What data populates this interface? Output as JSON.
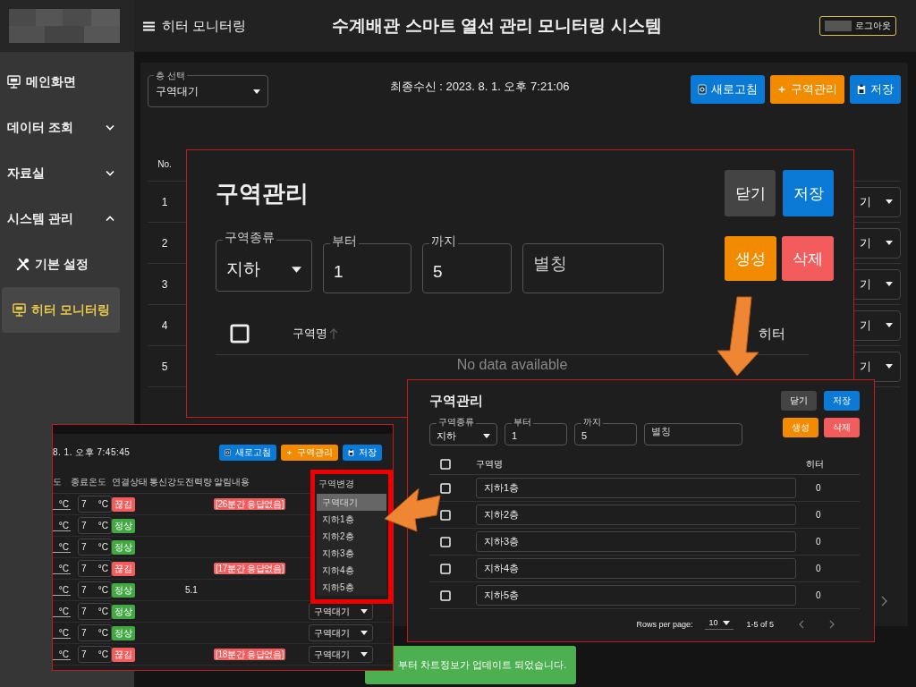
{
  "header": {
    "menu_title": "히터 모니터링",
    "title": "수계배관 스마트 열선 관리 모니터링 시스템",
    "logout": "로그아웃"
  },
  "sidebar": {
    "items": [
      {
        "label": "메인화면",
        "kind": "screen",
        "selected": false
      },
      {
        "label": "데이터 조회",
        "kind": "group",
        "expanded": false,
        "selected": false
      },
      {
        "label": "자료실",
        "kind": "group",
        "expanded": false,
        "selected": false
      },
      {
        "label": "시스템 관리",
        "kind": "group",
        "expanded": true,
        "selected": false,
        "children": [
          {
            "label": "기본 설정",
            "kind": "tools",
            "selected": false
          },
          {
            "label": "히터 모니터링",
            "kind": "screen",
            "selected": true
          }
        ]
      }
    ]
  },
  "toolbar": {
    "floor_select": {
      "label": "층 선택",
      "value": "구역대기"
    },
    "last_received": "최종수신 : 2023. 8. 1. 오후 7:21:06",
    "buttons": [
      {
        "label": "새로고침",
        "kind": "refresh"
      },
      {
        "label": "구역관리",
        "kind": "add"
      },
      {
        "label": "저장",
        "kind": "save"
      }
    ]
  },
  "table": {
    "columns": [
      "No."
    ],
    "rows": [
      {
        "no": "1",
        "zone": "기"
      },
      {
        "no": "2",
        "zone": "기"
      },
      {
        "no": "3",
        "zone": "기"
      },
      {
        "no": "4",
        "zone": "기"
      },
      {
        "no": "5",
        "zone": "기"
      }
    ]
  },
  "zone_dialog": {
    "title": "구역관리",
    "buttons": [
      {
        "label": "닫기",
        "kind": "close"
      },
      {
        "label": "저장",
        "kind": "save"
      }
    ],
    "zone_type": {
      "label": "구역종류",
      "value": "지하"
    },
    "from": {
      "label": "부터",
      "value": "1"
    },
    "to": {
      "label": "까지",
      "value": "5"
    },
    "alias": {
      "placeholder": "별칭"
    },
    "actions": [
      {
        "label": "생성",
        "kind": "create"
      },
      {
        "label": "삭제",
        "kind": "delete"
      }
    ],
    "select_all": {
      "checked": false
    },
    "columns": [
      "구역명",
      "히터"
    ],
    "empty": "No data available"
  },
  "zone_dialog_result": {
    "title": "구역관리",
    "buttons": [
      {
        "label": "닫기",
        "kind": "close"
      },
      {
        "label": "저장",
        "kind": "save"
      }
    ],
    "zone_type": {
      "label": "구역종류",
      "value": "지하"
    },
    "from": {
      "label": "부터",
      "value": "1"
    },
    "to": {
      "label": "까지",
      "value": "5"
    },
    "alias": {
      "placeholder": "별칭"
    },
    "actions": [
      {
        "label": "생성",
        "kind": "create"
      },
      {
        "label": "삭제",
        "kind": "delete"
      }
    ],
    "select_all": {
      "checked": false
    },
    "columns": [
      "구역명",
      "히터"
    ],
    "rows": [
      {
        "name": "지하1층",
        "heater": "0",
        "checked": false
      },
      {
        "name": "지하2층",
        "heater": "0",
        "checked": false
      },
      {
        "name": "지하3층",
        "heater": "0",
        "checked": false
      },
      {
        "name": "지하4층",
        "heater": "0",
        "checked": false
      },
      {
        "name": "지하5층",
        "heater": "0",
        "checked": false
      }
    ],
    "pagination": {
      "label": "Rows per page:",
      "rows_per_page": "10",
      "range": "1-5 of 5"
    }
  },
  "monitor_inset": {
    "last_received": "8. 1. 오후 7:45:45",
    "buttons": [
      {
        "label": "새로고침",
        "kind": "refresh"
      },
      {
        "label": "구역관리",
        "kind": "add"
      },
      {
        "label": "저장",
        "kind": "save"
      }
    ],
    "columns": [
      "도",
      "종료온도",
      "연결상태",
      "통신강도",
      "전력량",
      "알림내용",
      "구역변경"
    ],
    "rows": [
      {
        "start_unit": "°C",
        "end_value": "7",
        "end_unit": "°C",
        "status": {
          "label": "끊김",
          "kind": "error"
        },
        "alert": "[26분간 응답없음]"
      },
      {
        "start_unit": "°C",
        "end_value": "7",
        "end_unit": "°C",
        "status": {
          "label": "정상",
          "kind": "ok"
        }
      },
      {
        "start_unit": "°C",
        "end_value": "7",
        "end_unit": "°C",
        "status": {
          "label": "정상",
          "kind": "ok"
        }
      },
      {
        "start_unit": "°C",
        "end_value": "7",
        "end_unit": "°C",
        "status": {
          "label": "끊김",
          "kind": "error"
        },
        "alert": "[17분간 응답없음]"
      },
      {
        "start_unit": "°C",
        "end_value": "7",
        "end_unit": "°C",
        "status": {
          "label": "정상",
          "kind": "ok"
        },
        "power": "5.1"
      },
      {
        "start_unit": "°C",
        "end_value": "7",
        "end_unit": "°C",
        "status": {
          "label": "정상",
          "kind": "ok"
        },
        "zone": "구역대기"
      },
      {
        "start_unit": "°C",
        "end_value": "7",
        "end_unit": "°C",
        "status": {
          "label": "정상",
          "kind": "ok"
        },
        "zone": "구역대기"
      },
      {
        "start_unit": "°C",
        "end_value": "7",
        "end_unit": "°C",
        "status": {
          "label": "끊김",
          "kind": "error"
        },
        "alert": "[18분간 응답없음]",
        "zone": "구역대기"
      }
    ],
    "zone_menu": [
      {
        "label": "구역대기",
        "selected": true
      },
      {
        "label": "지하1층",
        "selected": false
      },
      {
        "label": "지하2층",
        "selected": false
      },
      {
        "label": "지하3층",
        "selected": false
      },
      {
        "label": "지하4층",
        "selected": false
      },
      {
        "label": "지하5층",
        "selected": false
      }
    ]
  },
  "toast": {
    "message": "부터 차트정보가 업데이트 되었습니다."
  }
}
